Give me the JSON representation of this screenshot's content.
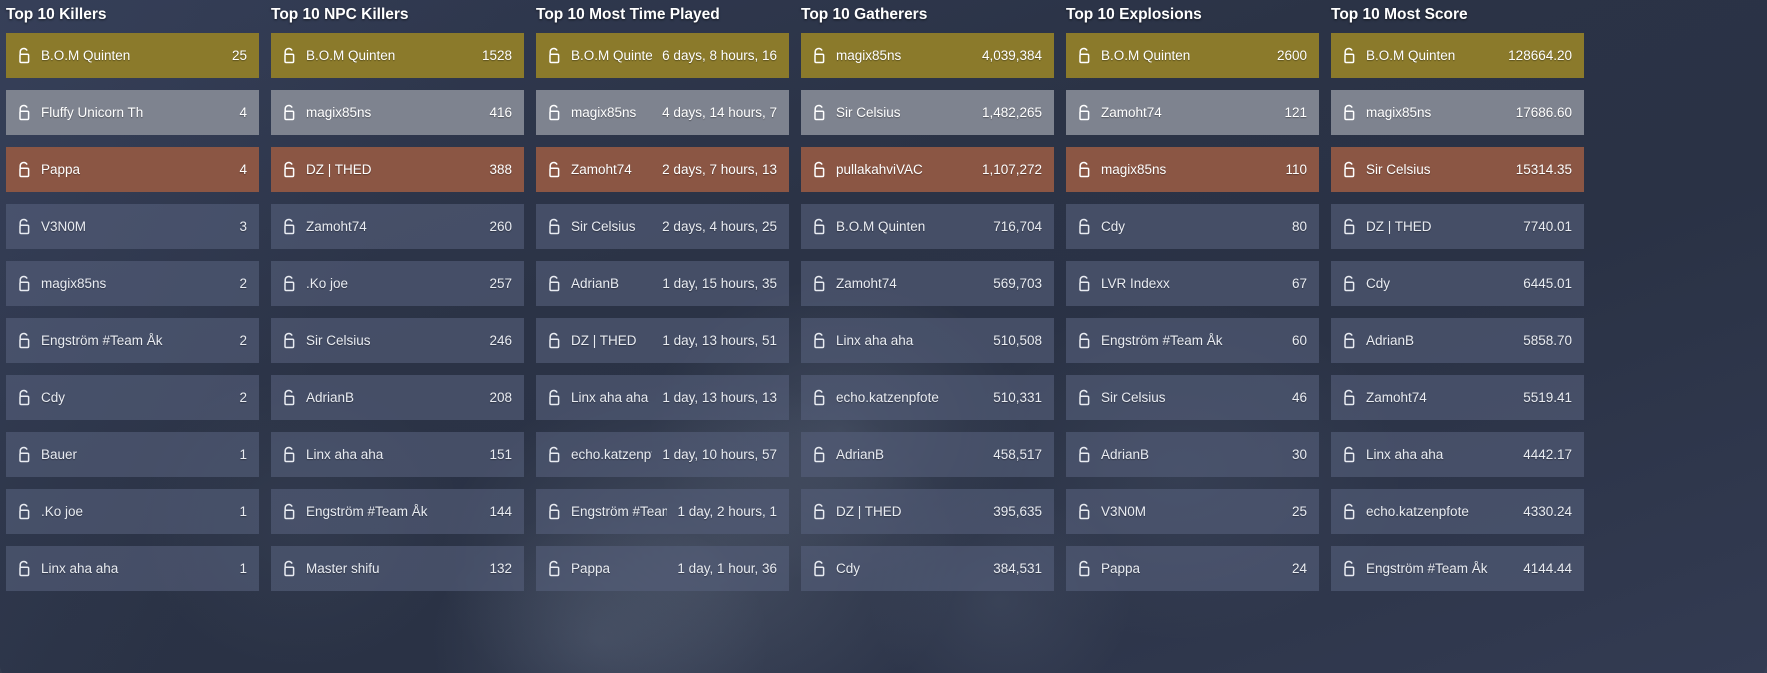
{
  "theme": {
    "background": "#2c3449",
    "row_default": "#56607a",
    "row_rank1": "#8b7a2b",
    "row_rank2": "#7e838f",
    "row_rank3": "#8b5644",
    "text": "#e9ecf2"
  },
  "row_icon": "unlocked-padlock-icon",
  "columns": [
    {
      "title": "Top 10 Killers",
      "rows": [
        {
          "name": "B.O.M Quinten",
          "value": "25"
        },
        {
          "name": "Fluffy Unicorn Th",
          "value": "4"
        },
        {
          "name": "Pappa",
          "value": "4"
        },
        {
          "name": "V3N0M",
          "value": "3"
        },
        {
          "name": "magix85ns",
          "value": "2"
        },
        {
          "name": "Engström #Team Åk",
          "value": "2"
        },
        {
          "name": "Cdy",
          "value": "2"
        },
        {
          "name": "Bauer",
          "value": "1"
        },
        {
          "name": ".Ko joe",
          "value": "1"
        },
        {
          "name": "Linx aha aha",
          "value": "1"
        }
      ]
    },
    {
      "title": "Top 10 NPC Killers",
      "rows": [
        {
          "name": "B.O.M Quinten",
          "value": "1528"
        },
        {
          "name": "magix85ns",
          "value": "416"
        },
        {
          "name": "DZ | THED",
          "value": "388"
        },
        {
          "name": "Zamoht74",
          "value": "260"
        },
        {
          "name": ".Ko joe",
          "value": "257"
        },
        {
          "name": "Sir Celsius",
          "value": "246"
        },
        {
          "name": "AdrianB",
          "value": "208"
        },
        {
          "name": "Linx aha aha",
          "value": "151"
        },
        {
          "name": "Engström #Team Åk",
          "value": "144"
        },
        {
          "name": "Master shifu",
          "value": "132"
        }
      ]
    },
    {
      "title": "Top 10 Most Time Played",
      "rows": [
        {
          "name": "B.O.M Quinten",
          "value": "6 days, 8 hours, 16"
        },
        {
          "name": "magix85ns",
          "value": "4 days, 14 hours, 7"
        },
        {
          "name": "Zamoht74",
          "value": "2 days, 7 hours, 13"
        },
        {
          "name": "Sir Celsius",
          "value": "2 days, 4 hours, 25"
        },
        {
          "name": "AdrianB",
          "value": "1 day, 15 hours, 35"
        },
        {
          "name": "DZ | THED",
          "value": "1 day, 13 hours, 51"
        },
        {
          "name": "Linx aha aha",
          "value": "1 day, 13 hours, 13"
        },
        {
          "name": "echo.katzenpfote",
          "value": "1 day, 10 hours, 57"
        },
        {
          "name": "Engström #Team Åk",
          "value": "1 day, 2 hours, 1"
        },
        {
          "name": "Pappa",
          "value": "1 day, 1 hour, 36"
        }
      ]
    },
    {
      "title": "Top 10 Gatherers",
      "rows": [
        {
          "name": "magix85ns",
          "value": "4,039,384"
        },
        {
          "name": "Sir Celsius",
          "value": "1,482,265"
        },
        {
          "name": "pullakahviVAC",
          "value": "1,107,272"
        },
        {
          "name": "B.O.M Quinten",
          "value": "716,704"
        },
        {
          "name": "Zamoht74",
          "value": "569,703"
        },
        {
          "name": "Linx aha aha",
          "value": "510,508"
        },
        {
          "name": "echo.katzenpfote",
          "value": "510,331"
        },
        {
          "name": "AdrianB",
          "value": "458,517"
        },
        {
          "name": "DZ | THED",
          "value": "395,635"
        },
        {
          "name": "Cdy",
          "value": "384,531"
        }
      ]
    },
    {
      "title": "Top 10 Explosions",
      "rows": [
        {
          "name": "B.O.M Quinten",
          "value": "2600"
        },
        {
          "name": "Zamoht74",
          "value": "121"
        },
        {
          "name": "magix85ns",
          "value": "110"
        },
        {
          "name": "Cdy",
          "value": "80"
        },
        {
          "name": "LVR Indexx",
          "value": "67"
        },
        {
          "name": "Engström #Team Åk",
          "value": "60"
        },
        {
          "name": "Sir Celsius",
          "value": "46"
        },
        {
          "name": "AdrianB",
          "value": "30"
        },
        {
          "name": "V3N0M",
          "value": "25"
        },
        {
          "name": "Pappa",
          "value": "24"
        }
      ]
    },
    {
      "title": "Top 10 Most Score",
      "rows": [
        {
          "name": "B.O.M Quinten",
          "value": "128664.20"
        },
        {
          "name": "magix85ns",
          "value": "17686.60"
        },
        {
          "name": "Sir Celsius",
          "value": "15314.35"
        },
        {
          "name": "DZ | THED",
          "value": "7740.01"
        },
        {
          "name": "Cdy",
          "value": "6445.01"
        },
        {
          "name": "AdrianB",
          "value": "5858.70"
        },
        {
          "name": "Zamoht74",
          "value": "5519.41"
        },
        {
          "name": "Linx aha aha",
          "value": "4442.17"
        },
        {
          "name": "echo.katzenpfote",
          "value": "4330.24"
        },
        {
          "name": "Engström #Team Åk",
          "value": "4144.44"
        }
      ]
    }
  ]
}
